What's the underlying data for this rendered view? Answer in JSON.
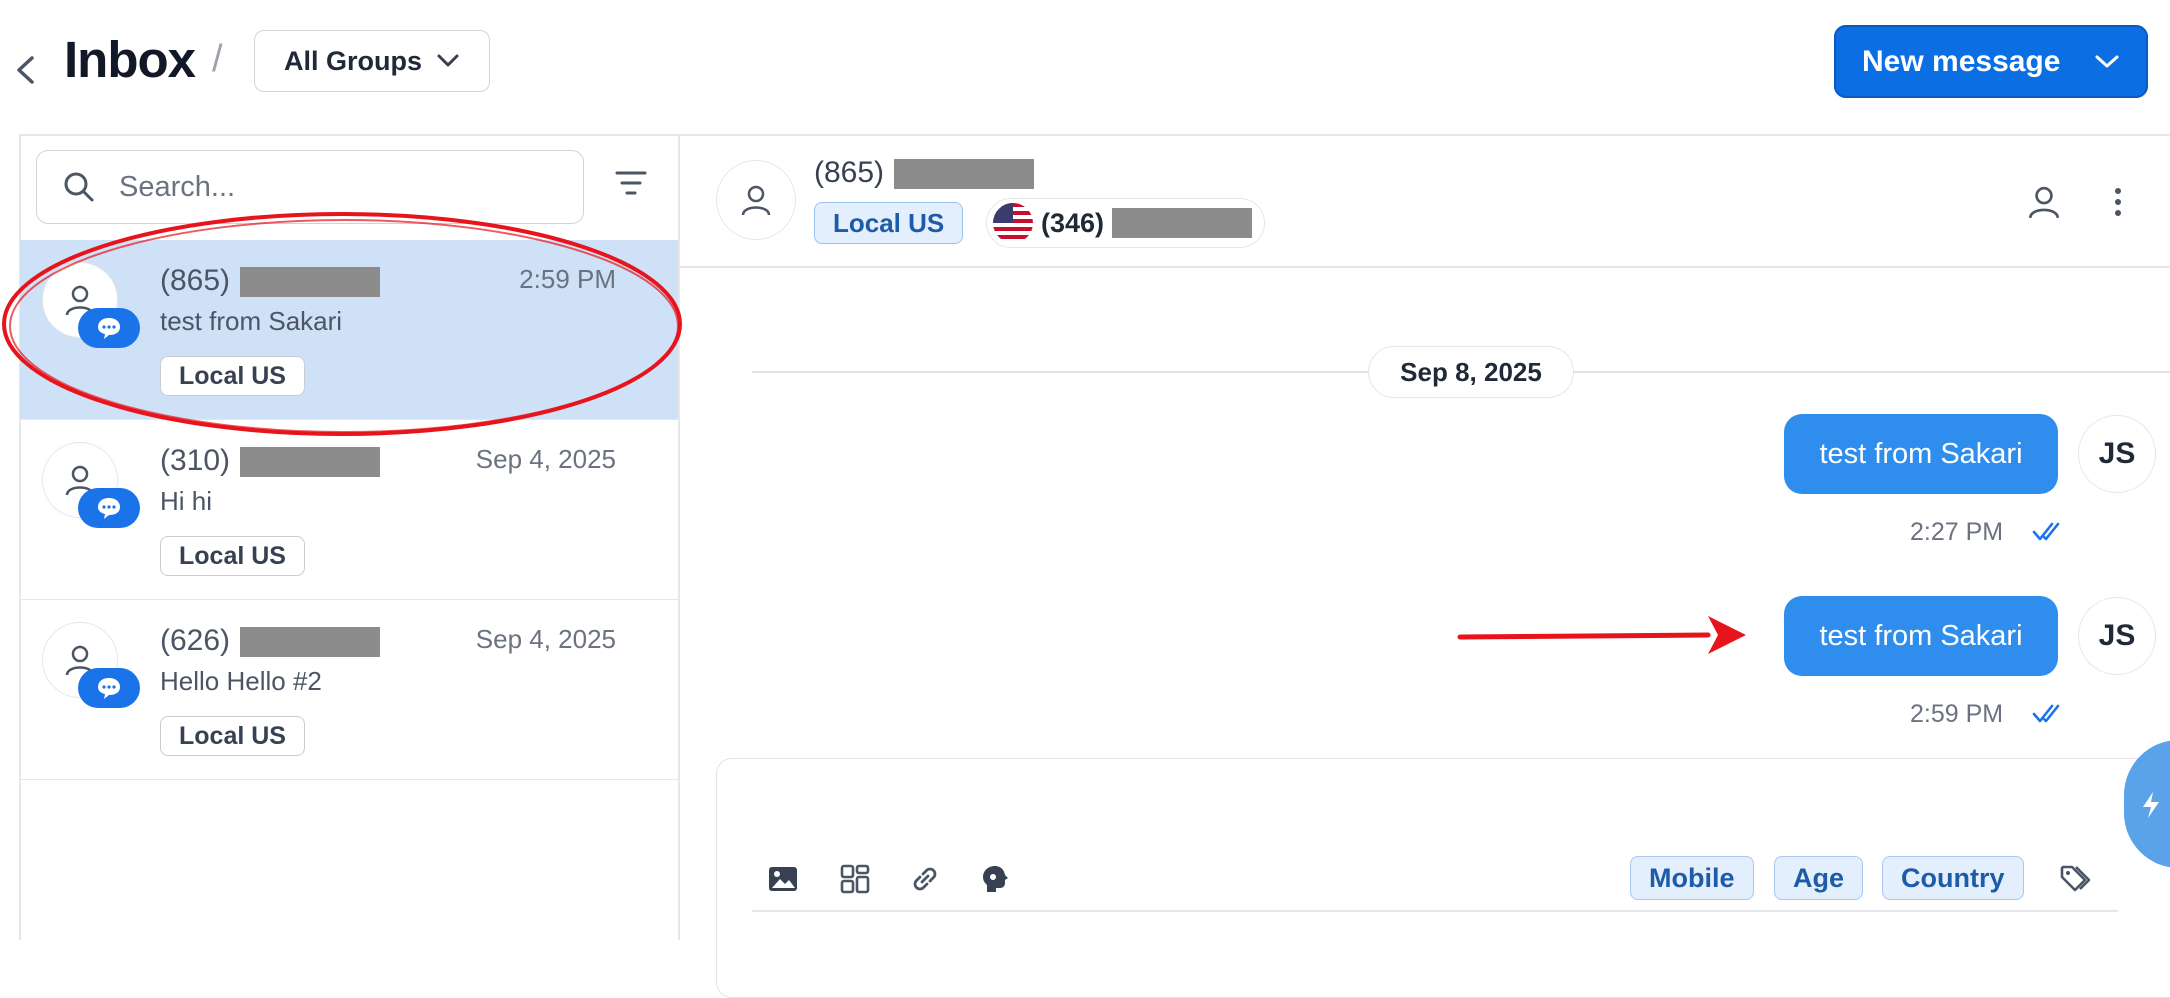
{
  "header": {
    "title": "Inbox",
    "separator": "/",
    "group_filter": "All Groups",
    "new_message_label": "New message"
  },
  "sidebar": {
    "search_placeholder": "Search...",
    "conversations": [
      {
        "phone": "(865)",
        "snippet": "test from Sakari",
        "time": "2:59 PM",
        "tag": "Local US",
        "selected": true
      },
      {
        "phone": "(310)",
        "snippet": "Hi hi",
        "time": "Sep 4, 2025",
        "tag": "Local US",
        "selected": false
      },
      {
        "phone": "(626)",
        "snippet": "Hello Hello #2",
        "time": "Sep 4, 2025",
        "tag": "Local US",
        "selected": false
      }
    ]
  },
  "chat": {
    "contact_phone": "(865)",
    "group_tag": "Local US",
    "sender_number": "(346)",
    "date_divider": "Sep 8, 2025",
    "messages": [
      {
        "text": "test from Sakari",
        "time": "2:27 PM",
        "initials": "JS"
      },
      {
        "text": "test from Sakari",
        "time": "2:59 PM",
        "initials": "JS"
      }
    ]
  },
  "composer": {
    "variables": [
      "Mobile",
      "Age",
      "Country"
    ]
  },
  "colors": {
    "accent": "#0b6fe3",
    "bubble": "#2e8ded",
    "selected_row": "#cfe1f7",
    "annotation": "#e8141c"
  }
}
